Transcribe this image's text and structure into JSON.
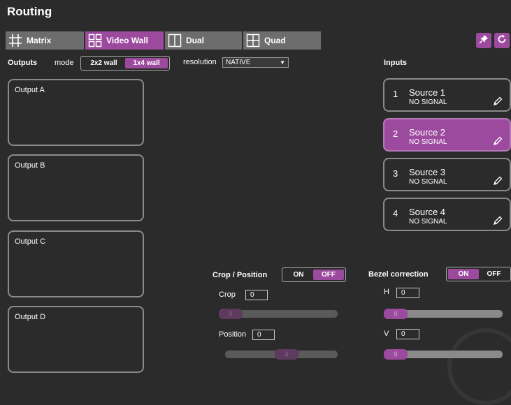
{
  "app": {
    "title": "Routing"
  },
  "tabs": [
    {
      "label": "Matrix",
      "icon": "matrix-grid-icon",
      "active": false
    },
    {
      "label": "Video Wall",
      "icon": "video-wall-icon",
      "active": true
    },
    {
      "label": "Dual",
      "icon": "dual-icon",
      "active": false
    },
    {
      "label": "Quad",
      "icon": "quad-icon",
      "active": false
    }
  ],
  "toolbar": {
    "pin_icon": "pin-icon",
    "refresh_icon": "refresh-icon"
  },
  "outputs": {
    "heading": "Outputs",
    "mode_label": "mode",
    "mode_options": [
      "2x2 wall",
      "1x4 wall"
    ],
    "mode_selected": "1x4 wall",
    "resolution_label": "resolution",
    "resolution_value": "NATIVE",
    "items": [
      "Output A",
      "Output B",
      "Output C",
      "Output D"
    ]
  },
  "inputs": {
    "heading": "Inputs",
    "items": [
      {
        "num": "1",
        "name": "Source 1",
        "signal": "NO SIGNAL",
        "selected": false
      },
      {
        "num": "2",
        "name": "Source 2",
        "signal": "NO SIGNAL",
        "selected": true
      },
      {
        "num": "3",
        "name": "Source 3",
        "signal": "NO SIGNAL",
        "selected": false
      },
      {
        "num": "4",
        "name": "Source 4",
        "signal": "NO SIGNAL",
        "selected": false
      }
    ]
  },
  "crop_position": {
    "heading": "Crop / Position",
    "on_label": "ON",
    "off_label": "OFF",
    "state": "OFF",
    "crop_label": "Crop",
    "crop_value": "0",
    "position_label": "Position",
    "position_value": "0"
  },
  "bezel": {
    "heading": "Bezel correction",
    "on_label": "ON",
    "off_label": "OFF",
    "state": "ON",
    "h_label": "H",
    "h_value": "0",
    "v_label": "V",
    "v_value": "0"
  },
  "colors": {
    "accent": "#9c4a9e",
    "background": "#2b2b2b",
    "tab_inactive": "#6d6d6d",
    "border": "#8a8a8a"
  }
}
